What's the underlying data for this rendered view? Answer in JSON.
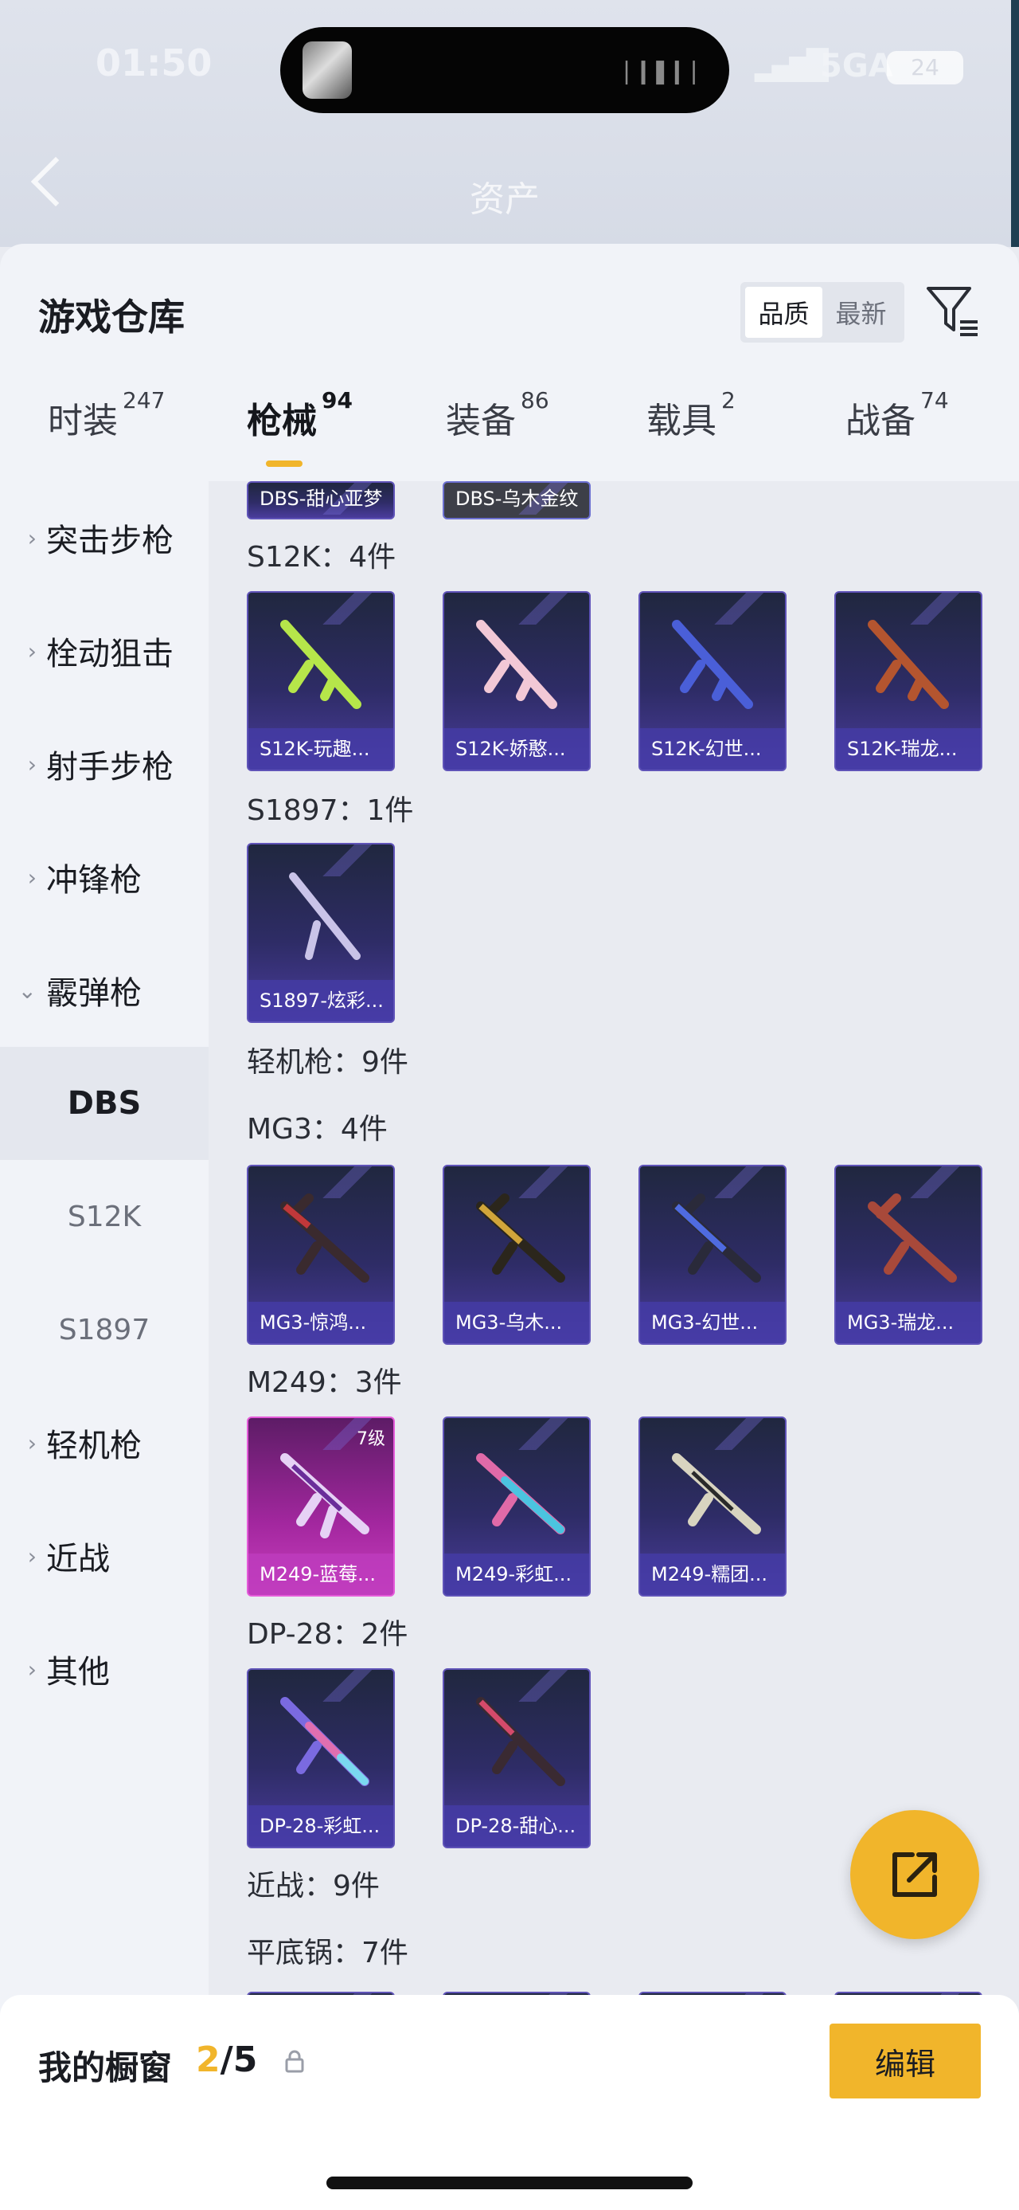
{
  "status_bar": {
    "time": "01:50",
    "network": "5GA",
    "battery": "24"
  },
  "header": {
    "title": "资产"
  },
  "sheet": {
    "title": "游戏仓库",
    "sort": {
      "options": [
        "品质",
        "最新"
      ],
      "active": "品质"
    }
  },
  "tabs": [
    {
      "label": "时装",
      "count": "247"
    },
    {
      "label": "枪械",
      "count": "94"
    },
    {
      "label": "装备",
      "count": "86"
    },
    {
      "label": "载具",
      "count": "2"
    },
    {
      "label": "战备",
      "count": "74"
    }
  ],
  "sidebar": {
    "categories": [
      "突击步枪",
      "栓动狙击",
      "射手步枪",
      "冲锋枪",
      "霰弹枪"
    ],
    "shotgun_subs": [
      "DBS",
      "S12K",
      "S1897"
    ],
    "more_categories": [
      "轻机枪",
      "近战",
      "其他"
    ]
  },
  "grid": {
    "dbs_partial": [
      "DBS-甜心亚梦",
      "DBS-乌木金纹"
    ],
    "groups": {
      "s12k": "S12K：4件",
      "s1897": "S1897：1件",
      "lmg": "轻机枪：9件",
      "mg3": "MG3：4件",
      "m249": "M249：3件",
      "dp28": "DP-28：2件",
      "melee": "近战：9件",
      "pan": "平底锅：7件"
    },
    "s12k_items": [
      "S12K-玩趣...",
      "S12K-娇憨...",
      "S12K-幻世...",
      "S12K-瑞龙..."
    ],
    "s1897_items": [
      "S1897-炫彩..."
    ],
    "mg3_items": [
      "MG3-惊鸿...",
      "MG3-乌木...",
      "MG3-幻世...",
      "MG3-瑞龙..."
    ],
    "m249_items": [
      "M249-蓝莓...",
      "M249-彩虹...",
      "M249-糯团..."
    ],
    "m249_level": "7级",
    "dp28_items": [
      "DP-28-彩虹...",
      "DP-28-甜心..."
    ]
  },
  "showcase": {
    "label": "我的橱窗",
    "current": "2",
    "total": "/5",
    "edit": "编辑"
  },
  "colors": {
    "accent": "#f1b52b",
    "tile": "#3a3287",
    "tile_highlight": "#c93fbe"
  }
}
